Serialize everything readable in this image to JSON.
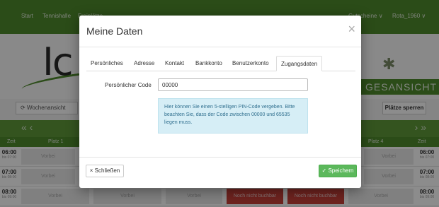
{
  "topnav": {
    "items": [
      "Start",
      "Tennishalle",
      "Freiplätze"
    ],
    "right_items": [
      "Gutscheine ∨",
      "Rota_1960 ∨"
    ]
  },
  "hero": {
    "logo_text": "Ic",
    "banner_text": "GESANSICHT"
  },
  "toolbar": {
    "wochen_label": "Wochenansicht",
    "plaetze_label": "Plätze sperren"
  },
  "nav": {
    "prev": "« ‹",
    "next": "› »"
  },
  "columns": {
    "zeit_left": "Zeit",
    "platz1": "Platz 1",
    "platz4": "Platz 4",
    "zeit_right": "Zeit"
  },
  "rows": [
    {
      "time": "06:00",
      "sub": "bis 07:00"
    },
    {
      "time": "07:00",
      "sub": "bis 08:00"
    },
    {
      "time": "08:00",
      "sub": "bis 09:00"
    }
  ],
  "slots": {
    "vorbei": "Vorbei",
    "nicht_buchbar": "Noch nicht buchbar"
  },
  "modal": {
    "title": "Meine Daten",
    "close_symbol": "×",
    "tabs": [
      "Persönliches",
      "Adresse",
      "Kontakt",
      "Bankkonto",
      "Benutzerkonto",
      "Zugangsdaten"
    ],
    "active_tab": "Zugangsdaten",
    "field_label": "Persönlicher Code",
    "field_value": "00000",
    "info_text": "Hier können Sie einen 5-stelligen PIN-Code vergeben. Bitte beachten Sie, dass der Code zwischen 00000 und 65535 liegen muss.",
    "close_button": "× Schließen",
    "save_button": "✓ Speichern"
  },
  "colors": {
    "brand_green": "#4f8a2c",
    "save_green": "#5cb85c",
    "info_bg": "#d6eef6",
    "info_text": "#31708f",
    "unavailable_red": "#c9403a"
  }
}
